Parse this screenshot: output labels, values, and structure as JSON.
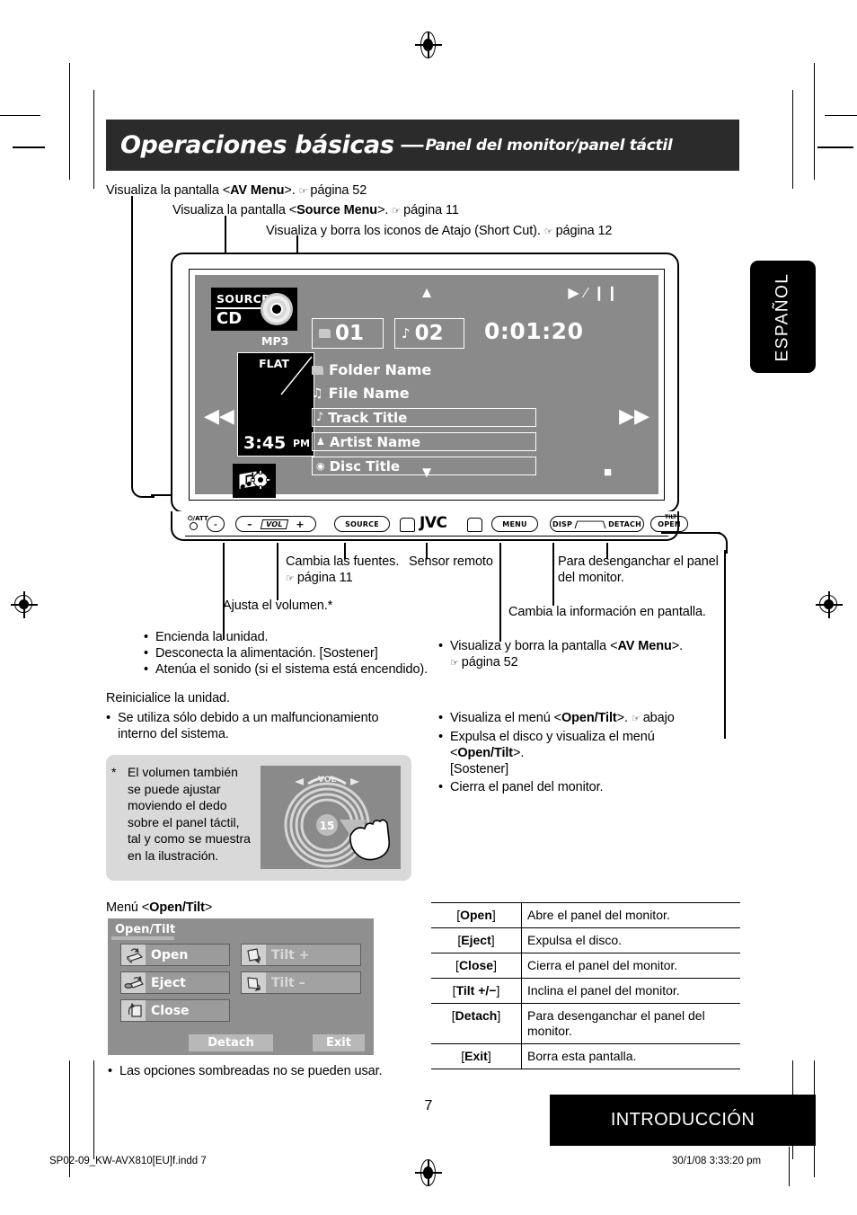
{
  "header": {
    "title_main": "Operaciones básicas",
    "dash": "—",
    "title_sub": "Panel del monitor/panel táctil"
  },
  "top_callouts": [
    {
      "text_before": "Visualiza la pantalla <",
      "bold": "AV Menu",
      "text_after": ">.",
      "ref": "página 52",
      "hand": "☞"
    },
    {
      "text_before": "Visualiza la pantalla <",
      "bold": "Source Menu",
      "text_after": ">.",
      "ref": "página 11",
      "hand": "☞"
    },
    {
      "text_before": "Visualiza y borra los iconos de Atajo (Short Cut).",
      "bold": "",
      "text_after": "",
      "ref": "página 12",
      "hand": "☞"
    }
  ],
  "monitor": {
    "source_label": "SOURCE",
    "source_value": "CD",
    "format_label": "MP3",
    "eq_label": "FLAT",
    "clock_time": "3:45",
    "clock_meridiem": "PM",
    "folder_number": "01",
    "track_number": "02",
    "elapsed_time": "0:01:20",
    "folder_name": "Folder Name",
    "file_name": "File Name",
    "track_title": "Track Title",
    "artist_name": "Artist Name",
    "disc_title": "Disc Title",
    "icons": {
      "prev": "◀◀",
      "next": "▶▶",
      "up": "▲",
      "down": "▼",
      "play_pause": "▶ ∕ ❙❙",
      "stop": "■",
      "file_note": "♫",
      "track_note": "♪",
      "artist": "👤",
      "disc": "💿"
    }
  },
  "panel_buttons": {
    "power_att": "⏻/ATT",
    "minus_small": "–",
    "vol_minus": "–",
    "vol_label": "VOL",
    "vol_plus": "+",
    "source": "SOURCE",
    "brand": "JVC",
    "menu": "MENU",
    "disp": "DISP",
    "detach": "DETACH",
    "open": "OPEN",
    "tilt": "TILT"
  },
  "diagram_labels": {
    "sources": "Cambia las fuentes.",
    "sources_ref": "página 11",
    "remote_sensor": "Sensor remoto",
    "detach_panel": "Para desenganchar el panel del monitor.",
    "change_info": "Cambia la información en pantalla.",
    "volume": "Ajusta el volumen.*"
  },
  "bullets_left": [
    "Encienda la unidad.",
    "Desconecta la alimentación. [Sostener]",
    "Atenúa el sonido (si el sistema está encendido)."
  ],
  "reset": {
    "heading": "Reinicialice la unidad.",
    "bullet": "Se utiliza sólo debido a un malfuncionamiento interno del sistema."
  },
  "bullets_right_top": {
    "text_before": "Visualiza y borra la pantalla <",
    "bold": "AV Menu",
    "text_after": ">.",
    "ref": "página 52"
  },
  "bullets_right_bottom": [
    {
      "pre": "Visualiza el menú <",
      "bold": "Open/Tilt",
      "post": ">.",
      "ref": "abajo",
      "tail": ""
    },
    {
      "pre": "Expulsa el disco y visualiza el menú <",
      "bold": "Open/Tilt",
      "post": ">.",
      "ref": "",
      "tail": "[Sostener]"
    },
    {
      "pre": "Cierra el panel del monitor.",
      "bold": "",
      "post": "",
      "ref": "",
      "tail": ""
    }
  ],
  "note": {
    "marker": "*",
    "text": "El volumen también se puede ajustar moviendo el dedo sobre el panel táctil, tal y como se muestra en la ilustración.",
    "illustration_vol_label": "VOL",
    "illustration_value": "15"
  },
  "open_tilt": {
    "caption_pre": "Menú <",
    "caption_bold": "Open/Tilt",
    "caption_post": ">",
    "panel_title": "Open/Tilt",
    "buttons": [
      {
        "label": "Open",
        "icon": "open-panel-icon",
        "dimmed": false
      },
      {
        "label": "Eject",
        "icon": "eject-disc-icon",
        "dimmed": false
      },
      {
        "label": "Close",
        "icon": "close-panel-icon",
        "dimmed": false
      },
      {
        "label": "Tilt +",
        "icon": "tilt-up-icon",
        "dimmed": true
      },
      {
        "label": "Tilt –",
        "icon": "tilt-down-icon",
        "dimmed": true
      }
    ],
    "detach_label": "Detach",
    "exit_label": "Exit",
    "footnote": "Las opciones sombreadas no se pueden usar."
  },
  "table": {
    "rows": [
      {
        "key_pre": "[",
        "key": "Open",
        "key_post": "]",
        "desc": "Abre el panel del monitor."
      },
      {
        "key_pre": "[",
        "key": "Eject",
        "key_post": "]",
        "desc": "Expulsa el disco."
      },
      {
        "key_pre": "[",
        "key": "Close",
        "key_post": "]",
        "desc": "Cierra el panel del monitor."
      },
      {
        "key_pre": "[",
        "key": "Tilt +/−",
        "key_post": "]",
        "desc": "Inclina el panel del monitor."
      },
      {
        "key_pre": "[",
        "key": "Detach",
        "key_post": "]",
        "desc": "Para desenganchar el panel del monitor."
      },
      {
        "key_pre": "[",
        "key": "Exit",
        "key_post": "]",
        "desc": "Borra esta pantalla."
      }
    ]
  },
  "side_tab": {
    "language": "ESPAÑOL"
  },
  "footer": {
    "page_number": "7",
    "section": "INTRODUCCIÓN",
    "file_name": "SP02-09_KW-AVX810[EU]f.indd   7",
    "date_time": "30/1/08   3:33:20 pm"
  },
  "colors": {
    "banner": "#2b2b2b",
    "screen_gray": "#8a8a8a",
    "note_box": "#d9d9d9",
    "panel_gray": "#8f8f8f"
  }
}
